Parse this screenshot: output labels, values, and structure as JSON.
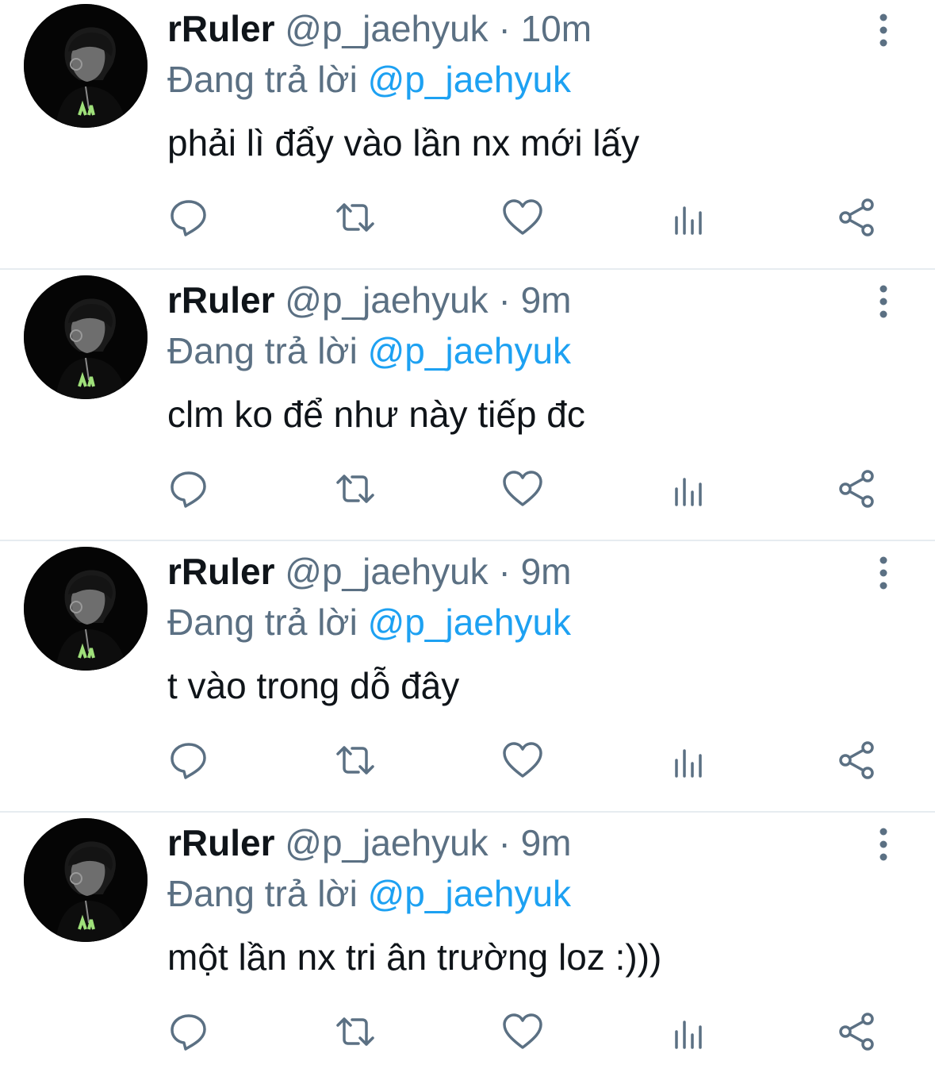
{
  "colors": {
    "text": "#0f1419",
    "secondary": "#5b7083",
    "accent": "#1da1f2",
    "divider": "#e6ecf0",
    "icon": "#5b7083"
  },
  "tweets": [
    {
      "display_name": "rRuler",
      "handle": "@p_jaehyuk",
      "separator": "·",
      "time": "10m",
      "reply_prefix": "Đang trả lời",
      "reply_to": "@p_jaehyuk",
      "text": "phải lì đẩy vào lần nx mới lấy",
      "icons": [
        "reply-icon",
        "retweet-icon",
        "like-icon",
        "analytics-icon",
        "share-icon",
        "more-icon"
      ]
    },
    {
      "display_name": "rRuler",
      "handle": "@p_jaehyuk",
      "separator": "·",
      "time": "9m",
      "reply_prefix": "Đang trả lời",
      "reply_to": "@p_jaehyuk",
      "text": "clm ko để như này tiếp đc",
      "icons": [
        "reply-icon",
        "retweet-icon",
        "like-icon",
        "analytics-icon",
        "share-icon",
        "more-icon"
      ]
    },
    {
      "display_name": "rRuler",
      "handle": "@p_jaehyuk",
      "separator": "·",
      "time": "9m",
      "reply_prefix": "Đang trả lời",
      "reply_to": "@p_jaehyuk",
      "text": "t vào trong dỗ đây",
      "icons": [
        "reply-icon",
        "retweet-icon",
        "like-icon",
        "analytics-icon",
        "share-icon",
        "more-icon"
      ]
    },
    {
      "display_name": "rRuler",
      "handle": "@p_jaehyuk",
      "separator": "·",
      "time": "9m",
      "reply_prefix": "Đang trả lời",
      "reply_to": "@p_jaehyuk",
      "text": "một lần nx tri ân trường loz :)))",
      "icons": [
        "reply-icon",
        "retweet-icon",
        "like-icon",
        "analytics-icon",
        "share-icon",
        "more-icon"
      ]
    }
  ]
}
